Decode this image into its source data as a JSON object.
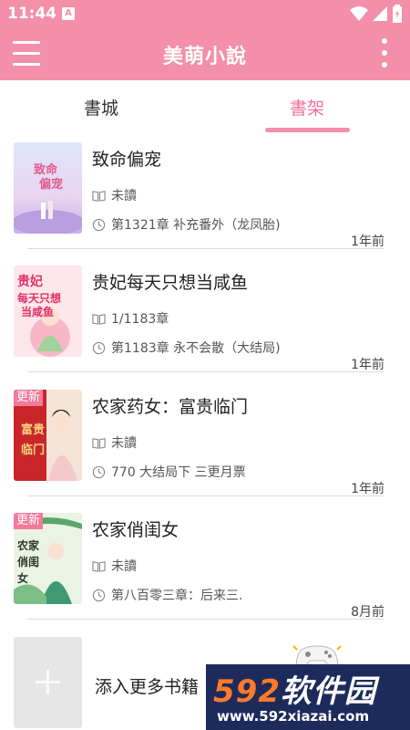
{
  "status_bar": {
    "time": "11:44",
    "notification_glyph": "A",
    "icons": [
      "wifi-icon",
      "signal-icon",
      "battery-icon"
    ]
  },
  "app_bar": {
    "title": "美萌小說",
    "left_icon": "menu-icon",
    "right_icon": "more-vert-icon"
  },
  "tabs": [
    {
      "label": "書城",
      "active": false
    },
    {
      "label": "書架",
      "active": true
    }
  ],
  "books": [
    {
      "title": "致命偏宠",
      "read_status": "未讀",
      "latest_chapter": "第1321章 补充番外（龙凤胎)",
      "time_ago": "1年前",
      "updated": false,
      "cover_text": "致命偏宠"
    },
    {
      "title": "贵妃每天只想当咸鱼",
      "read_status": "1/1183章",
      "latest_chapter": "第1183章 永不会散（大结局)",
      "time_ago": "1年前",
      "updated": false,
      "cover_text": "贵妃每天只想当咸鱼"
    },
    {
      "title": "农家药女：富贵临门",
      "read_status": "未讀",
      "latest_chapter": "770 大结局下  三更月票",
      "time_ago": "1年前",
      "updated": true,
      "cover_text": "富贵临门"
    },
    {
      "title": "农家俏闺女",
      "read_status": "未讀",
      "latest_chapter": "第八百零三章：后来三.",
      "time_ago": "8月前",
      "updated": true,
      "cover_text": "农家俏闺女"
    }
  ],
  "update_badge": "更新",
  "add_more": {
    "label": "添入更多书籍"
  },
  "watermark": {
    "brand_num": "592",
    "brand_text": "软件园",
    "url": "www.592xiazai.com"
  },
  "colors": {
    "accent": "#f38fab",
    "active_tab": "#f3709a",
    "watermark_bg": "#1d2b5c",
    "watermark_num": "#ff7a2a"
  }
}
